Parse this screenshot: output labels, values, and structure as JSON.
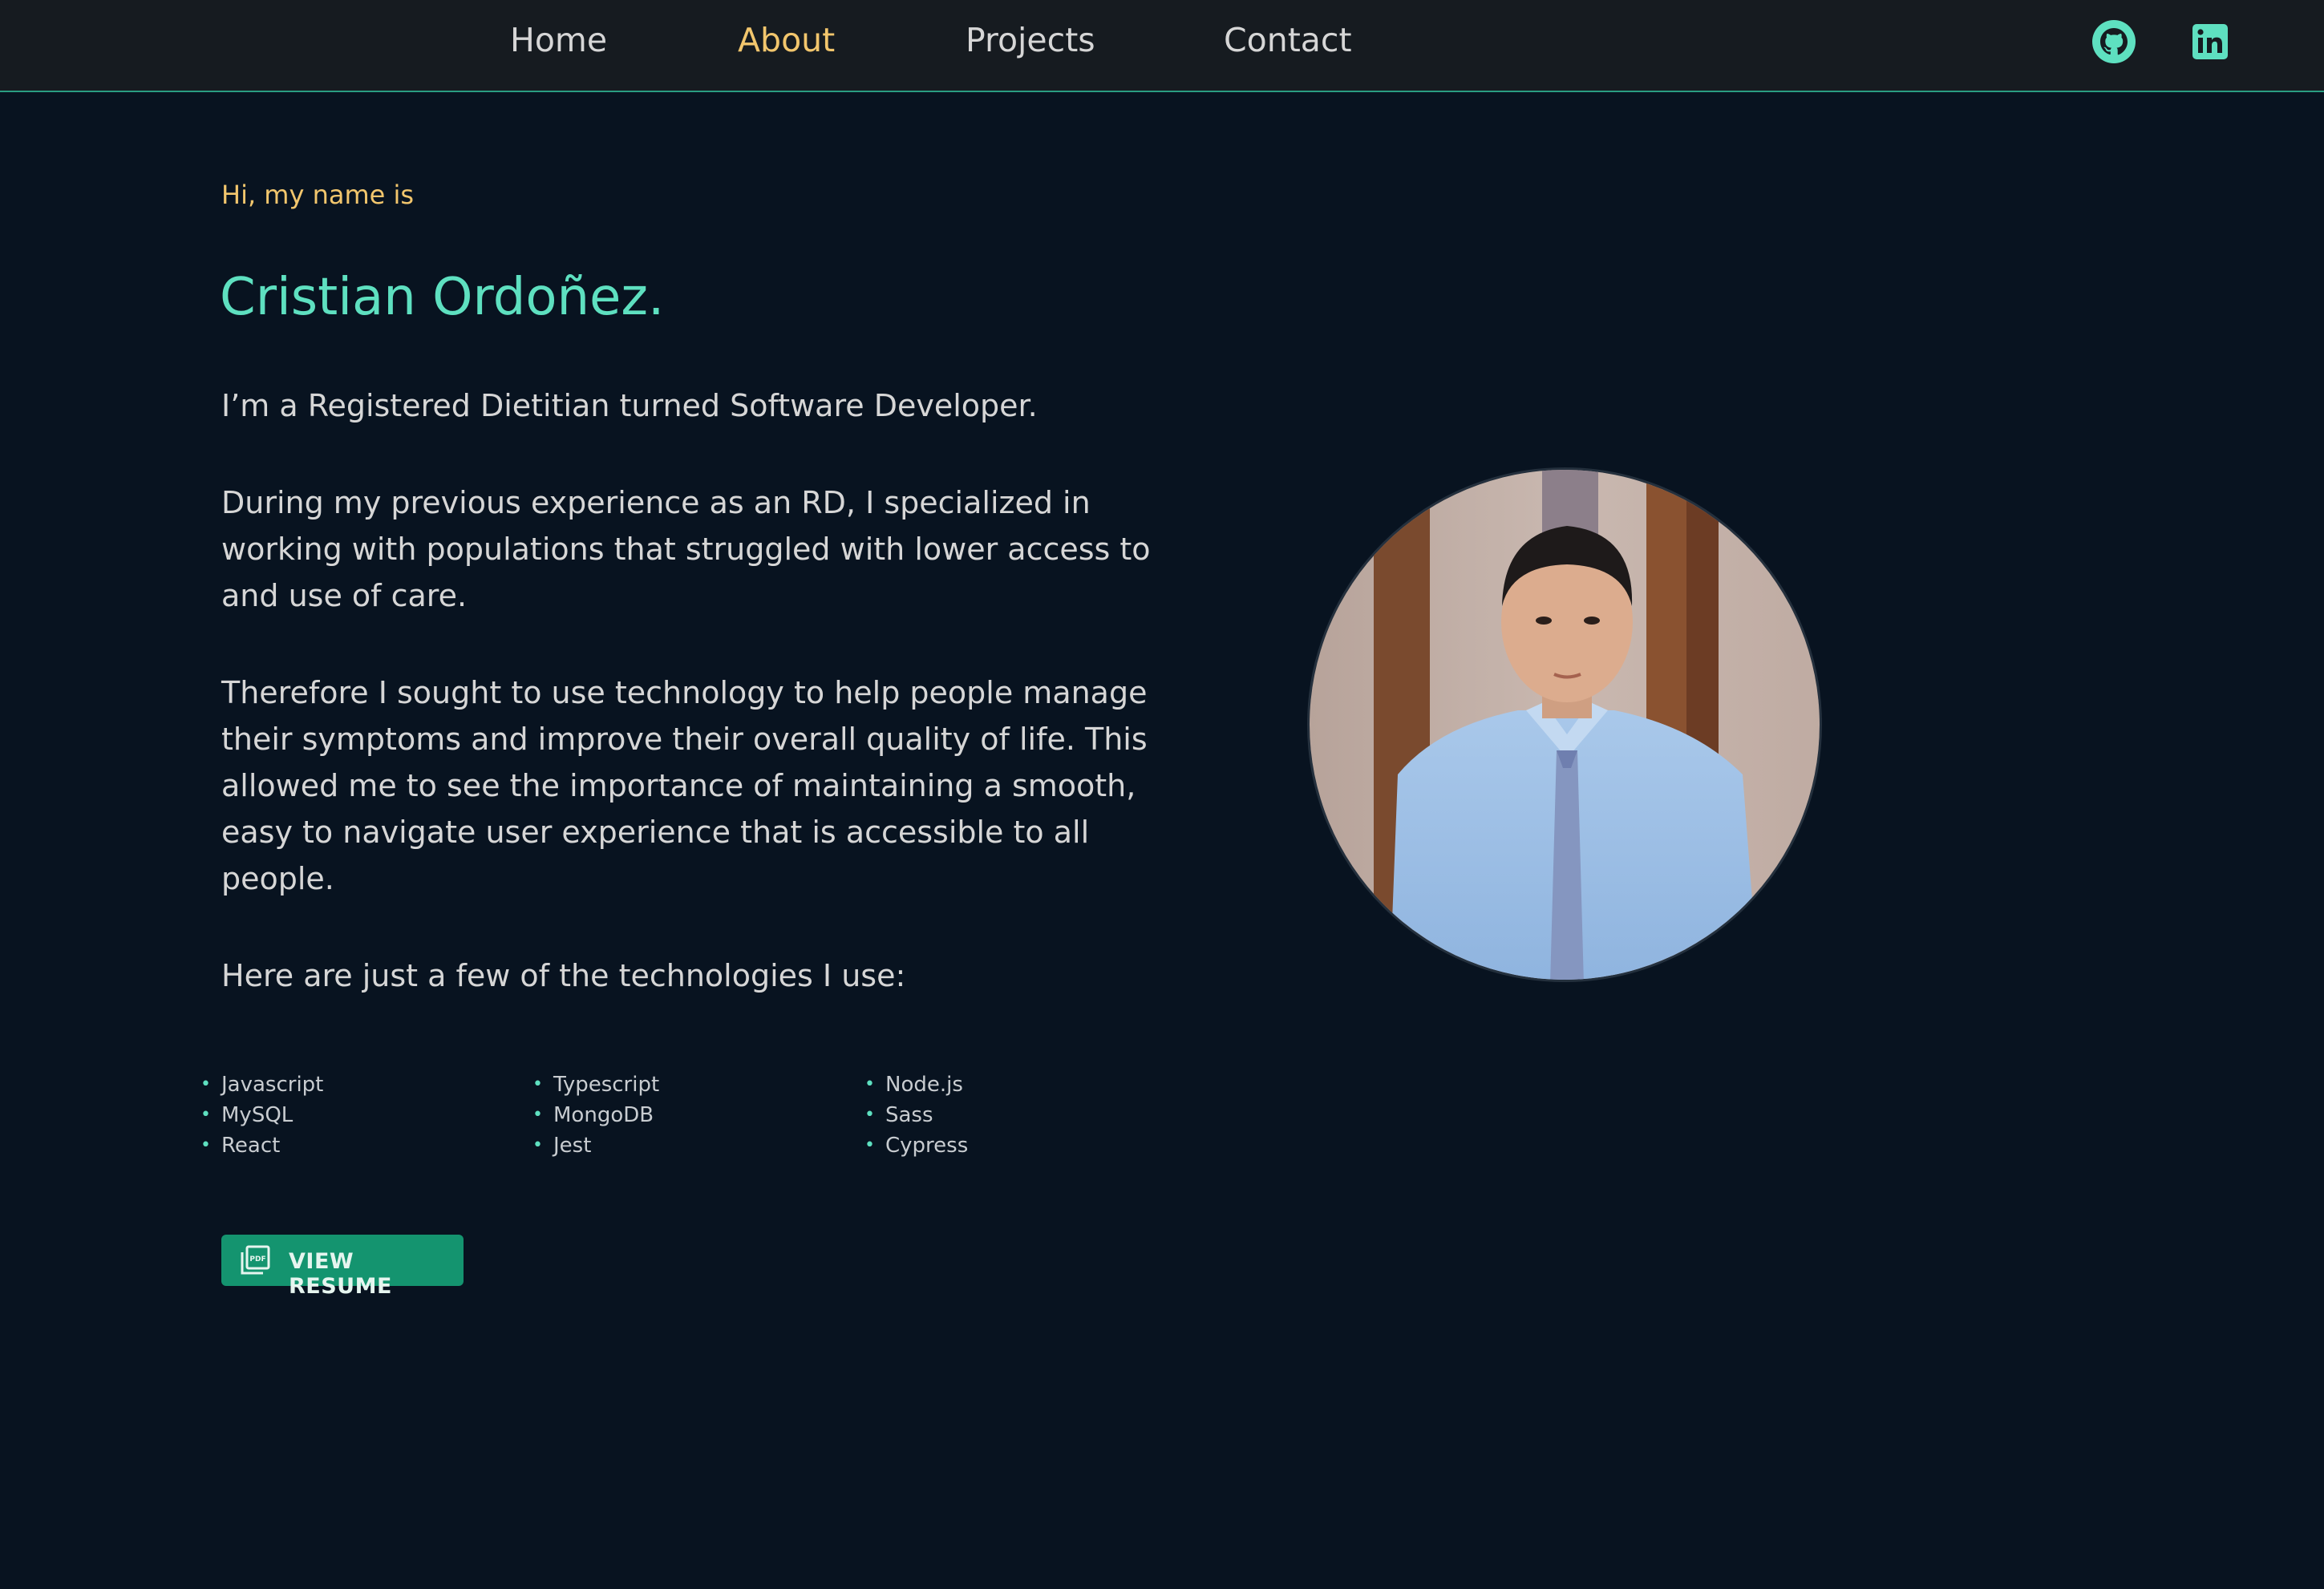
{
  "nav": {
    "home": "Home",
    "about": "About",
    "projects": "Projects",
    "contact": "Contact"
  },
  "social": {
    "github_icon": "github-icon",
    "linkedin_icon": "linkedin-icon"
  },
  "hero": {
    "intro": "Hi, my name is",
    "name": "Cristian Ordoñez.",
    "paragraphs": [
      "I’m a Registered Dietitian turned Software Developer.",
      "During my previous experience as an RD, I specialized in working with populations that struggled with lower access to and use of care.",
      "Therefore I sought to use technology to help people manage their symptoms and improve their overall quality of life. This allowed me to see the importance of maintaining a smooth, easy to navigate user experience that is accessible to all people.",
      "Here are just a few of the technologies I use:"
    ]
  },
  "technologies": [
    [
      "Javascript",
      "MySQL",
      "React"
    ],
    [
      "Typescript",
      "MongoDB",
      "Jest"
    ],
    [
      "Node.js",
      "Sass",
      "Cypress"
    ]
  ],
  "resume_button": {
    "label": "VIEW RESUME",
    "icon": "pdf-icon"
  },
  "colors": {
    "background": "#081320",
    "navbar": "#161b20",
    "accent_teal": "#5ee0c0",
    "accent_gold": "#f2c66d",
    "button": "#14946f"
  }
}
